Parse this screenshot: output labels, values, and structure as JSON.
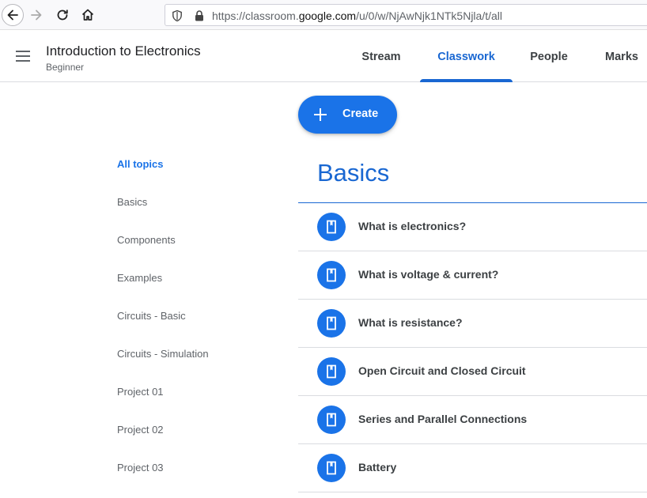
{
  "browser": {
    "url_prefix": "https://classroom.",
    "url_host": "google.com",
    "url_path": "/u/0/w/NjAwNjk1NTk5Njla/t/all"
  },
  "header": {
    "title": "Introduction to Electronics",
    "subtitle": "Beginner",
    "tabs": [
      {
        "label": "Stream",
        "active": false
      },
      {
        "label": "Classwork",
        "active": true
      },
      {
        "label": "People",
        "active": false
      },
      {
        "label": "Marks",
        "active": false
      }
    ]
  },
  "create_button": {
    "label": "Create"
  },
  "topics": [
    {
      "label": "All topics",
      "active": true
    },
    {
      "label": "Basics"
    },
    {
      "label": "Components"
    },
    {
      "label": "Examples"
    },
    {
      "label": "Circuits - Basic"
    },
    {
      "label": "Circuits - Simulation"
    },
    {
      "label": "Project 01"
    },
    {
      "label": "Project 02"
    },
    {
      "label": "Project 03"
    }
  ],
  "section": {
    "title": "Basics",
    "items": [
      {
        "title": "What is electronics?",
        "icon": "material-icon"
      },
      {
        "title": "What is voltage & current?",
        "icon": "material-icon"
      },
      {
        "title": "What is resistance?",
        "icon": "material-icon"
      },
      {
        "title": "Open Circuit and Closed Circuit",
        "icon": "material-icon"
      },
      {
        "title": "Series and Parallel Connections",
        "icon": "material-icon"
      },
      {
        "title": "Battery",
        "icon": "material-icon"
      }
    ]
  },
  "colors": {
    "accent": "#1967d2",
    "button": "#1a73e8"
  }
}
